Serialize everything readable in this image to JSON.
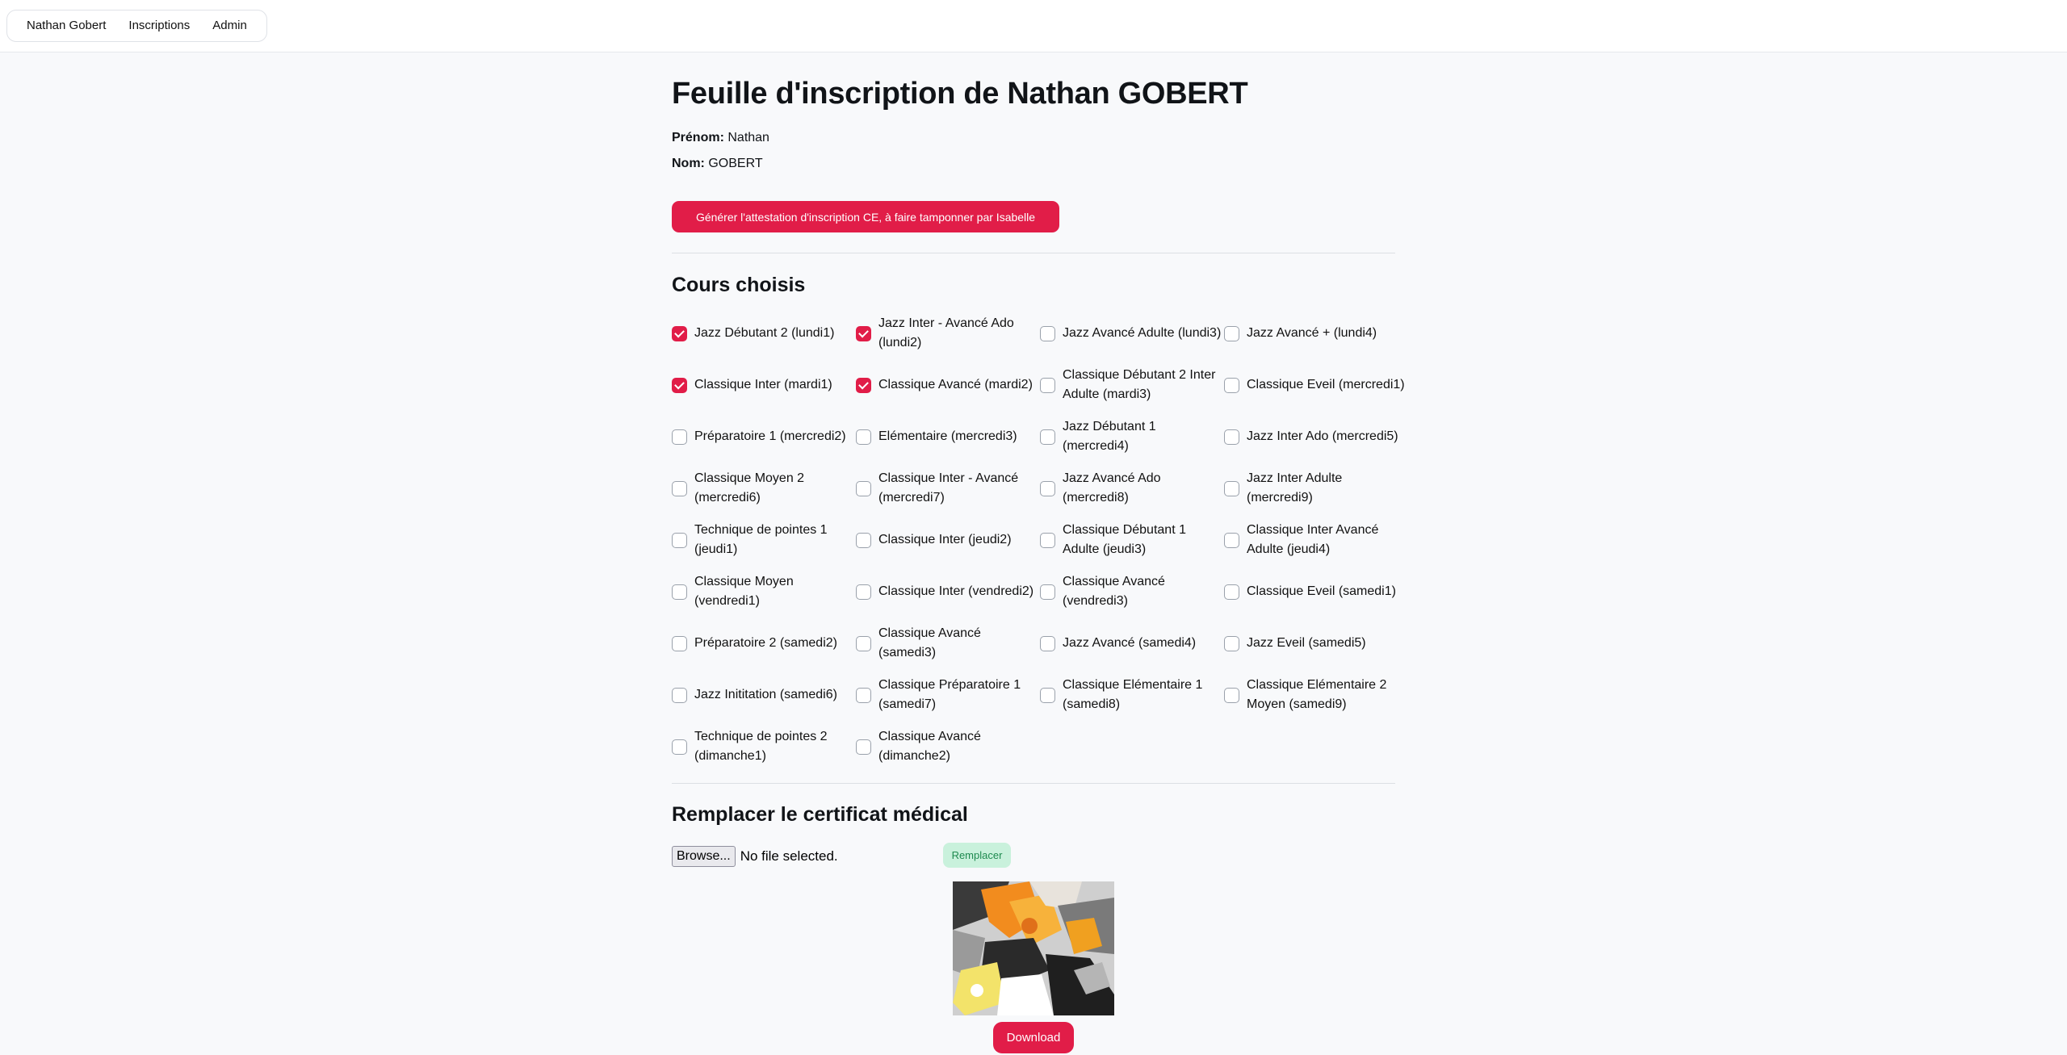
{
  "nav": {
    "items": [
      {
        "label": "Nathan Gobert"
      },
      {
        "label": "Inscriptions"
      },
      {
        "label": "Admin"
      }
    ]
  },
  "page": {
    "title": "Feuille d'inscription de Nathan GOBERT",
    "prenom_label": "Prénom:",
    "prenom_value": "Nathan",
    "nom_label": "Nom:",
    "nom_value": "GOBERT",
    "attestation_button": "Générer l'attestation d'inscription CE, à faire tamponner par Isabelle"
  },
  "courses": {
    "heading": "Cours choisis",
    "items": [
      {
        "label": "Jazz Débutant 2 (lundi1)",
        "checked": true
      },
      {
        "label": "Jazz Inter - Avancé Ado (lundi2)",
        "checked": true
      },
      {
        "label": "Jazz Avancé Adulte (lundi3)",
        "checked": false
      },
      {
        "label": "Jazz Avancé + (lundi4)",
        "checked": false
      },
      {
        "label": "Classique Inter (mardi1)",
        "checked": true
      },
      {
        "label": "Classique Avancé (mardi2)",
        "checked": true
      },
      {
        "label": "Classique Débutant 2 Inter Adulte (mardi3)",
        "checked": false
      },
      {
        "label": "Classique Eveil (mercredi1)",
        "checked": false
      },
      {
        "label": "Préparatoire 1 (mercredi2)",
        "checked": false
      },
      {
        "label": "Elémentaire (mercredi3)",
        "checked": false
      },
      {
        "label": "Jazz Débutant 1 (mercredi4)",
        "checked": false
      },
      {
        "label": "Jazz Inter Ado (mercredi5)",
        "checked": false
      },
      {
        "label": "Classique Moyen 2 (mercredi6)",
        "checked": false
      },
      {
        "label": "Classique Inter - Avancé (mercredi7)",
        "checked": false
      },
      {
        "label": "Jazz Avancé Ado (mercredi8)",
        "checked": false
      },
      {
        "label": "Jazz Inter Adulte (mercredi9)",
        "checked": false
      },
      {
        "label": "Technique de pointes 1 (jeudi1)",
        "checked": false
      },
      {
        "label": "Classique Inter (jeudi2)",
        "checked": false
      },
      {
        "label": "Classique Débutant 1 Adulte (jeudi3)",
        "checked": false
      },
      {
        "label": "Classique Inter Avancé Adulte (jeudi4)",
        "checked": false
      },
      {
        "label": "Classique Moyen (vendredi1)",
        "checked": false
      },
      {
        "label": "Classique Inter (vendredi2)",
        "checked": false
      },
      {
        "label": "Classique Avancé (vendredi3)",
        "checked": false
      },
      {
        "label": "Classique Eveil (samedi1)",
        "checked": false
      },
      {
        "label": "Préparatoire 2 (samedi2)",
        "checked": false
      },
      {
        "label": "Classique Avancé (samedi3)",
        "checked": false
      },
      {
        "label": "Jazz Avancé (samedi4)",
        "checked": false
      },
      {
        "label": "Jazz Eveil (samedi5)",
        "checked": false
      },
      {
        "label": "Jazz Inititation (samedi6)",
        "checked": false
      },
      {
        "label": "Classique Préparatoire 1 (samedi7)",
        "checked": false
      },
      {
        "label": "Classique Elémentaire 1 (samedi8)",
        "checked": false
      },
      {
        "label": "Classique Elémentaire 2 Moyen (samedi9)",
        "checked": false
      },
      {
        "label": "Technique de pointes 2 (dimanche1)",
        "checked": false
      },
      {
        "label": "Classique Avancé (dimanche2)",
        "checked": false
      }
    ]
  },
  "certificate": {
    "heading": "Remplacer le certificat médical",
    "browse_label": "Browse...",
    "file_status": "No file selected.",
    "replace_button": "Remplacer",
    "download_button": "Download"
  },
  "colors": {
    "accent": "#e11d48",
    "replace_bg": "#c9f1dc",
    "replace_text": "#1e8a4f",
    "page_bg": "#f8f9fb"
  }
}
